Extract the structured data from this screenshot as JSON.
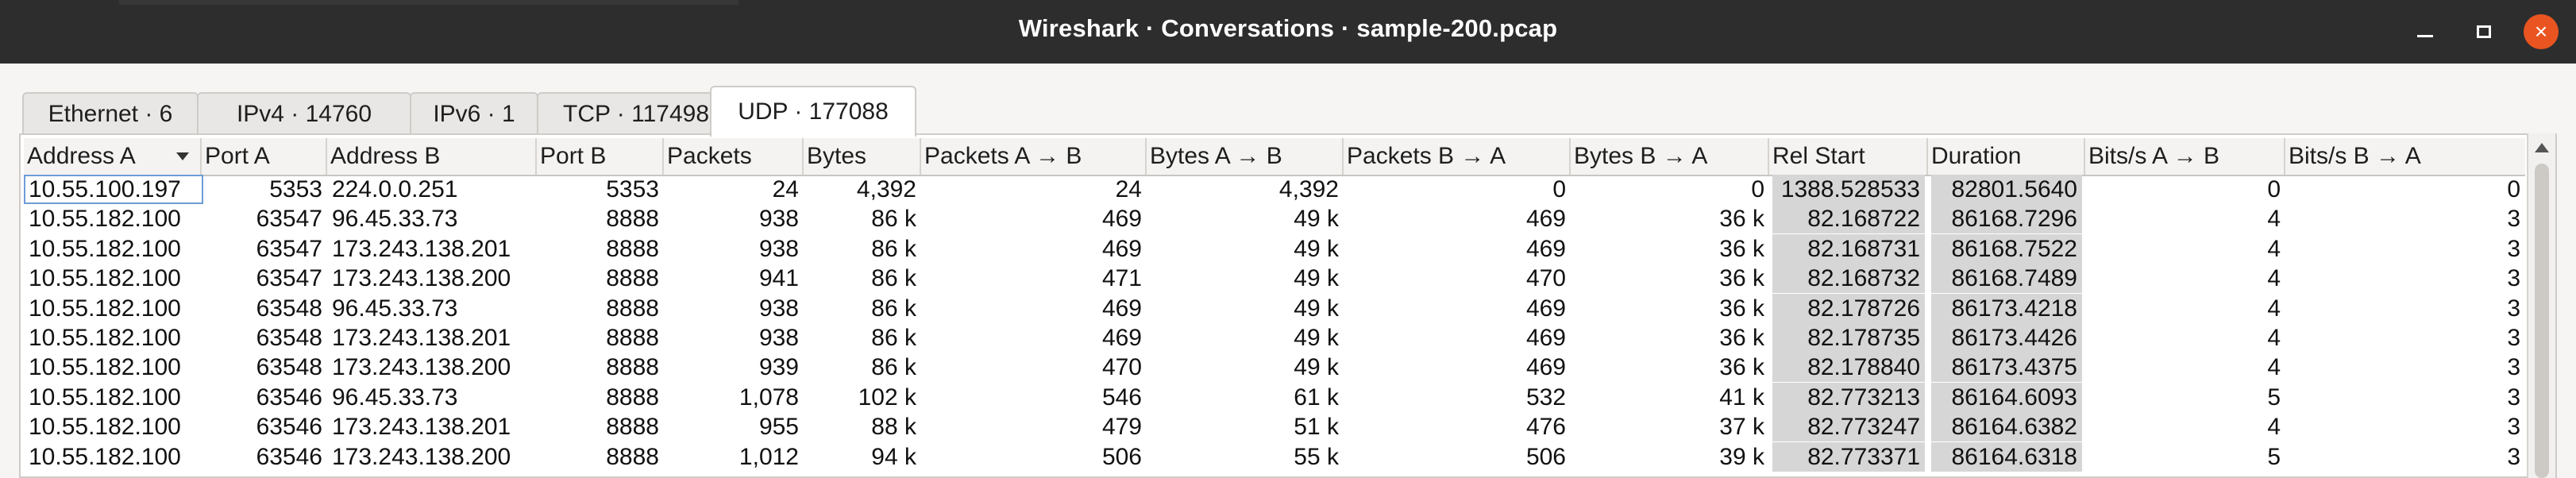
{
  "window": {
    "title": "Wireshark · Conversations · sample-200.pcap",
    "controls": {
      "minimize_icon": "minimize-icon",
      "maximize_icon": "maximize-icon",
      "close_icon": "close-icon",
      "close_glyph": "×",
      "close_color": "#e95420"
    }
  },
  "tabs": [
    {
      "label": "Ethernet · 6",
      "active": false
    },
    {
      "label": "IPv4 · 14760",
      "active": false
    },
    {
      "label": "IPv6 · 1",
      "active": false
    },
    {
      "label": "TCP · 117498",
      "active": false
    },
    {
      "label": "UDP · 177088",
      "active": true
    }
  ],
  "table": {
    "sort_icon": "sort-descending-icon",
    "columns": [
      "Address A",
      "Port A",
      "Address B",
      "Port B",
      "Packets",
      "Bytes",
      "Packets A → B",
      "Bytes A → B",
      "Packets B → A",
      "Bytes B → A",
      "Rel Start",
      "Duration",
      "Bits/s A → B",
      "Bits/s B → A"
    ],
    "rows": [
      [
        "10.55.100.197",
        "5353",
        "224.0.0.251",
        "5353",
        "24",
        "4,392",
        "24",
        "4,392",
        "0",
        "0",
        "1388.528533",
        "82801.5640",
        "0",
        "0"
      ],
      [
        "10.55.182.100",
        "63547",
        "96.45.33.73",
        "8888",
        "938",
        "86 k",
        "469",
        "49 k",
        "469",
        "36 k",
        "82.168722",
        "86168.7296",
        "4",
        "3"
      ],
      [
        "10.55.182.100",
        "63547",
        "173.243.138.201",
        "8888",
        "938",
        "86 k",
        "469",
        "49 k",
        "469",
        "36 k",
        "82.168731",
        "86168.7522",
        "4",
        "3"
      ],
      [
        "10.55.182.100",
        "63547",
        "173.243.138.200",
        "8888",
        "941",
        "86 k",
        "471",
        "49 k",
        "470",
        "36 k",
        "82.168732",
        "86168.7489",
        "4",
        "3"
      ],
      [
        "10.55.182.100",
        "63548",
        "96.45.33.73",
        "8888",
        "938",
        "86 k",
        "469",
        "49 k",
        "469",
        "36 k",
        "82.178726",
        "86173.4218",
        "4",
        "3"
      ],
      [
        "10.55.182.100",
        "63548",
        "173.243.138.201",
        "8888",
        "938",
        "86 k",
        "469",
        "49 k",
        "469",
        "36 k",
        "82.178735",
        "86173.4426",
        "4",
        "3"
      ],
      [
        "10.55.182.100",
        "63548",
        "173.243.138.200",
        "8888",
        "939",
        "86 k",
        "470",
        "49 k",
        "469",
        "36 k",
        "82.178840",
        "86173.4375",
        "4",
        "3"
      ],
      [
        "10.55.182.100",
        "63546",
        "96.45.33.73",
        "8888",
        "1,078",
        "102 k",
        "546",
        "61 k",
        "532",
        "41 k",
        "82.773213",
        "86164.6093",
        "5",
        "3"
      ],
      [
        "10.55.182.100",
        "63546",
        "173.243.138.201",
        "8888",
        "955",
        "88 k",
        "479",
        "51 k",
        "476",
        "37 k",
        "82.773247",
        "86164.6382",
        "4",
        "3"
      ],
      [
        "10.55.182.100",
        "63546",
        "173.243.138.200",
        "8888",
        "1,012",
        "94 k",
        "506",
        "55 k",
        "506",
        "39 k",
        "82.773371",
        "86164.6318",
        "5",
        "3"
      ]
    ]
  },
  "scrollbar": {
    "up_icon": "scroll-up-arrow-icon"
  }
}
